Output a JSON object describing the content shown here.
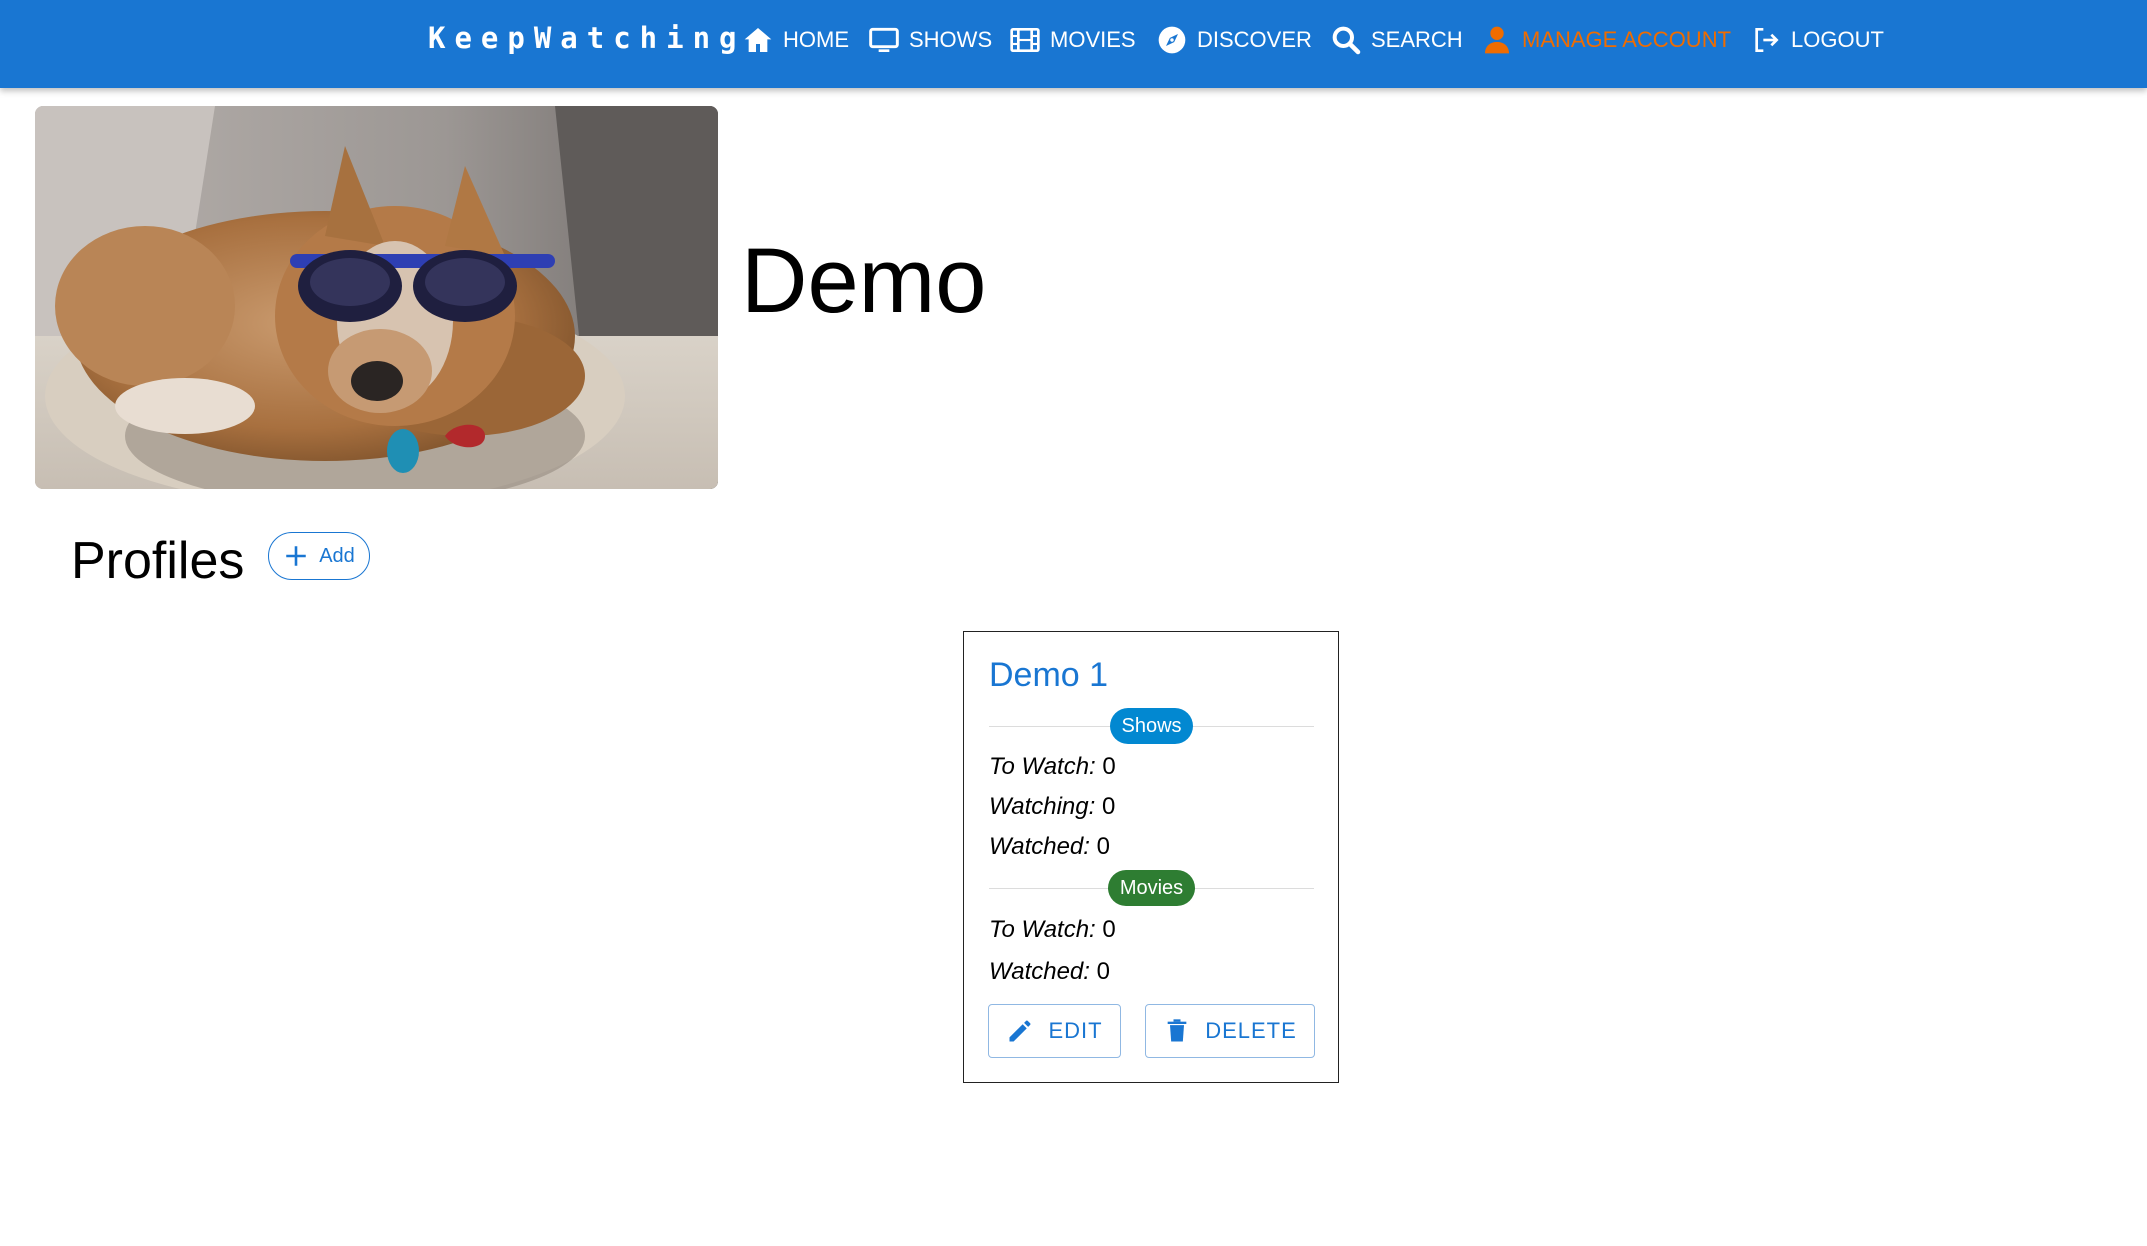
{
  "nav": {
    "brand": "KeepWatching",
    "items": [
      {
        "label": "HOME",
        "icon": "home-icon"
      },
      {
        "label": "SHOWS",
        "icon": "tv-icon"
      },
      {
        "label": "MOVIES",
        "icon": "film-icon"
      },
      {
        "label": "DISCOVER",
        "icon": "compass-icon"
      },
      {
        "label": "SEARCH",
        "icon": "search-icon"
      },
      {
        "label": "MANAGE ACCOUNT",
        "icon": "user-icon",
        "active": true
      },
      {
        "label": "LOGOUT",
        "icon": "logout-icon"
      }
    ],
    "colors": {
      "bar": "#1976d2",
      "active": "#ef6c00"
    }
  },
  "account": {
    "name": "Demo",
    "image_icon": "dog-with-sunglasses-photo"
  },
  "profiles": {
    "title": "Profiles",
    "add_label": "Add",
    "cards": [
      {
        "name": "Demo 1",
        "shows_label": "Shows",
        "shows": [
          {
            "key": "To Watch:",
            "value": "0"
          },
          {
            "key": "Watching:",
            "value": "0"
          },
          {
            "key": "Watched:",
            "value": "0"
          }
        ],
        "movies_label": "Movies",
        "movies": [
          {
            "key": "To Watch:",
            "value": "0"
          },
          {
            "key": "Watched:",
            "value": "0"
          }
        ],
        "edit_label": "EDIT",
        "delete_label": "DELETE"
      }
    ]
  }
}
